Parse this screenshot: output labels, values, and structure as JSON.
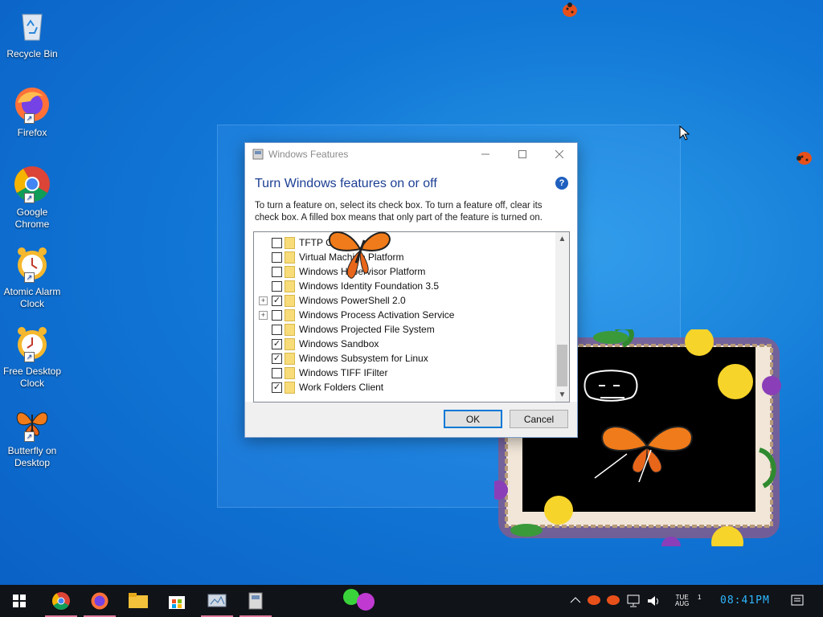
{
  "desktop": {
    "icons": [
      {
        "label": "Recycle Bin",
        "icon": "recycle-bin-icon"
      },
      {
        "label": "Firefox",
        "icon": "firefox-icon"
      },
      {
        "label": "Google Chrome",
        "icon": "chrome-icon"
      },
      {
        "label": "Atomic Alarm Clock",
        "icon": "alarm-clock-icon"
      },
      {
        "label": "Free Desktop Clock",
        "icon": "alarm-clock-icon"
      },
      {
        "label": "Butterfly on Desktop",
        "icon": "butterfly-icon"
      }
    ]
  },
  "dialog": {
    "window_title": "Windows Features",
    "heading": "Turn Windows features on or off",
    "help": "?",
    "description": "To turn a feature on, select its check box. To turn a feature off, clear its check box. A filled box means that only part of the feature is turned on.",
    "ok_label": "OK",
    "cancel_label": "Cancel",
    "features": [
      {
        "label": "TFTP Client",
        "checked": false,
        "expandable": false
      },
      {
        "label": "Virtual Machine Platform",
        "checked": false,
        "expandable": false
      },
      {
        "label": "Windows Hypervisor Platform",
        "checked": false,
        "expandable": false
      },
      {
        "label": "Windows Identity Foundation 3.5",
        "checked": false,
        "expandable": false
      },
      {
        "label": "Windows PowerShell 2.0",
        "checked": true,
        "expandable": true
      },
      {
        "label": "Windows Process Activation Service",
        "checked": false,
        "expandable": true
      },
      {
        "label": "Windows Projected File System",
        "checked": false,
        "expandable": false
      },
      {
        "label": "Windows Sandbox",
        "checked": true,
        "expandable": false
      },
      {
        "label": "Windows Subsystem for Linux",
        "checked": true,
        "expandable": false
      },
      {
        "label": "Windows TIFF IFilter",
        "checked": false,
        "expandable": false
      },
      {
        "label": "Work Folders Client",
        "checked": true,
        "expandable": false
      }
    ]
  },
  "taskbar": {
    "clock": "08:41PM",
    "day": "TUE",
    "month": "AUG",
    "date": "1"
  }
}
